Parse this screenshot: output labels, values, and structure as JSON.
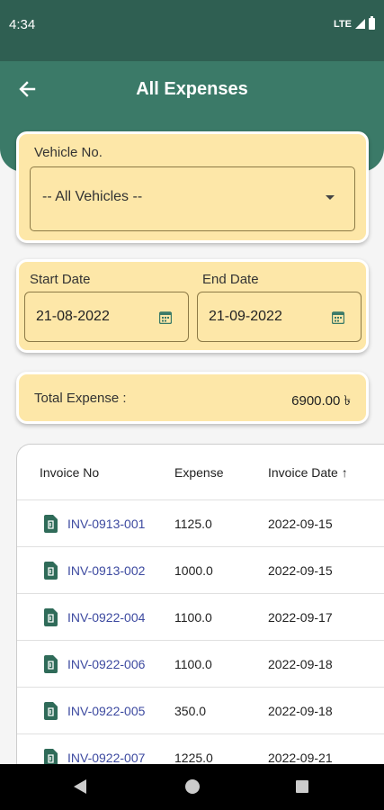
{
  "status_bar": {
    "time": "4:34",
    "network": "LTE"
  },
  "header": {
    "title": "All Expenses"
  },
  "vehicle_filter": {
    "label": "Vehicle No.",
    "selected": "-- All Vehicles --"
  },
  "date_filter": {
    "start_label": "Start Date",
    "start_value": "21-08-2022",
    "end_label": "End Date",
    "end_value": "21-09-2022"
  },
  "summary": {
    "total_label": "Total Expense :",
    "total_value": "6900.00 ৳"
  },
  "table": {
    "headers": {
      "invoice": "Invoice No",
      "expense": "Expense",
      "date": "Invoice Date ↑"
    },
    "rows": [
      {
        "invoice": "INV-0913-001",
        "expense": "1125.0",
        "date": "2022-09-15"
      },
      {
        "invoice": "INV-0913-002",
        "expense": "1000.0",
        "date": "2022-09-15"
      },
      {
        "invoice": "INV-0922-004",
        "expense": "1100.0",
        "date": "2022-09-17"
      },
      {
        "invoice": "INV-0922-006",
        "expense": "1100.0",
        "date": "2022-09-18"
      },
      {
        "invoice": "INV-0922-005",
        "expense": "350.0",
        "date": "2022-09-18"
      },
      {
        "invoice": "INV-0922-007",
        "expense": "1225.0",
        "date": "2022-09-21"
      }
    ]
  },
  "colors": {
    "primary_dark": "#2f5f52",
    "primary": "#3b7a68",
    "card": "#fde7a8",
    "link": "#3d4aa0"
  },
  "icons": {
    "back": "arrow-left-icon",
    "dropdown": "caret-down-icon",
    "calendar": "calendar-icon",
    "document": "receipt-icon"
  }
}
